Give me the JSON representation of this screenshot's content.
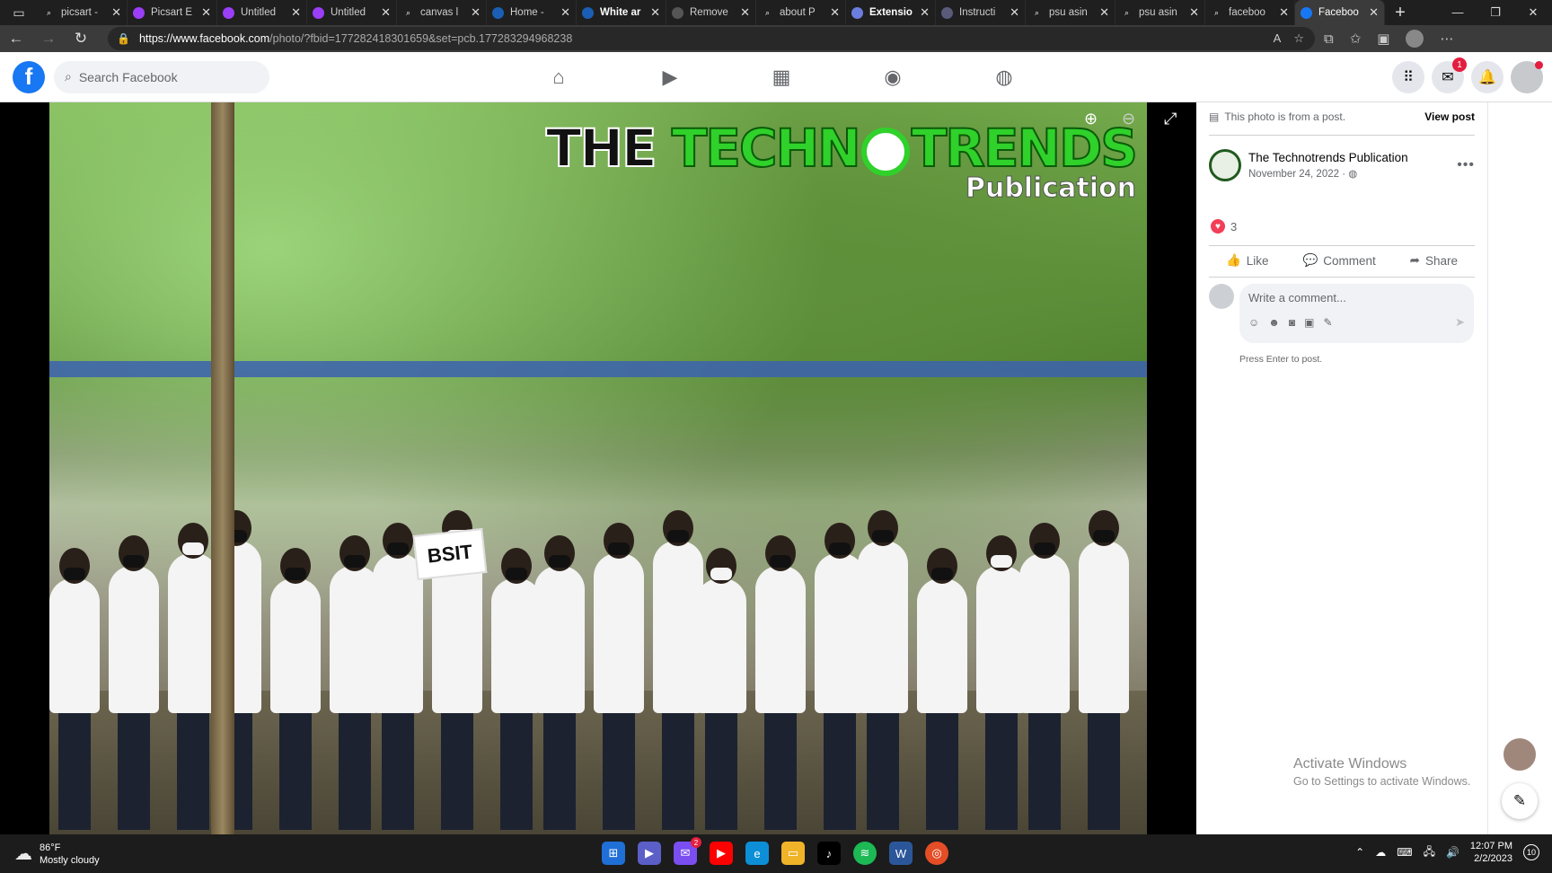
{
  "browser": {
    "tabs": [
      {
        "title": "picsart -",
        "icon": "search-icon",
        "color": "#1f1f1f"
      },
      {
        "title": "Picsart E",
        "icon": "picsart-icon",
        "color": "#9b3ef7"
      },
      {
        "title": "Untitled",
        "icon": "picsart-icon",
        "color": "#9b3ef7"
      },
      {
        "title": "Untitled",
        "icon": "picsart-icon",
        "color": "#9b3ef7"
      },
      {
        "title": "canvas l",
        "icon": "search-icon",
        "color": "#1f1f1f"
      },
      {
        "title": "Home -",
        "icon": "canva-icon",
        "color": "#1a5fb4"
      },
      {
        "title": "White ar",
        "icon": "canva-icon",
        "color": "#1a5fb4"
      },
      {
        "title": "Remove",
        "icon": "removebg-icon",
        "color": "#555555"
      },
      {
        "title": "about P",
        "icon": "search-icon",
        "color": "#1f1f1f"
      },
      {
        "title": "Extensio",
        "icon": "extension-icon",
        "color": "#6b7ee0"
      },
      {
        "title": "Instructi",
        "icon": "instruct-icon",
        "color": "#5a5a7a"
      },
      {
        "title": "psu asin",
        "icon": "search-icon",
        "color": "#1f1f1f"
      },
      {
        "title": "psu asin",
        "icon": "search-icon",
        "color": "#1f1f1f"
      },
      {
        "title": "faceboo",
        "icon": "search-icon",
        "color": "#1f1f1f"
      },
      {
        "title": "Faceboo",
        "icon": "facebook-icon",
        "color": "#1877f2"
      }
    ],
    "url_host": "https://www.facebook.com",
    "url_rest": "/photo/?fbid=177282418301659&set=pcb.177283294968238"
  },
  "facebook": {
    "search_placeholder": "Search Facebook",
    "messenger_badge": "1",
    "logo_letter": "f"
  },
  "photo": {
    "brand_the": "THE ",
    "brand_techno": "TECHN",
    "brand_trends": "TRENDS",
    "brand_sub": "Publication",
    "sign_text": "BSIT"
  },
  "post": {
    "note": "This photo is from a post.",
    "view_post": "View post",
    "author": "The Technotrends Publication",
    "date": "November 24, 2022 ·",
    "reaction_count": "3",
    "like": "Like",
    "comment": "Comment",
    "share": "Share",
    "comment_placeholder": "Write a comment...",
    "press_enter": "Press Enter to post."
  },
  "watermark": {
    "title": "Activate Windows",
    "subtitle": "Go to Settings to activate Windows."
  },
  "taskbar": {
    "temperature": "86°F",
    "condition": "Mostly cloudy",
    "messenger_badge": "2",
    "time": "12:07 PM",
    "date": "2/2/2023",
    "notifications": "10"
  }
}
